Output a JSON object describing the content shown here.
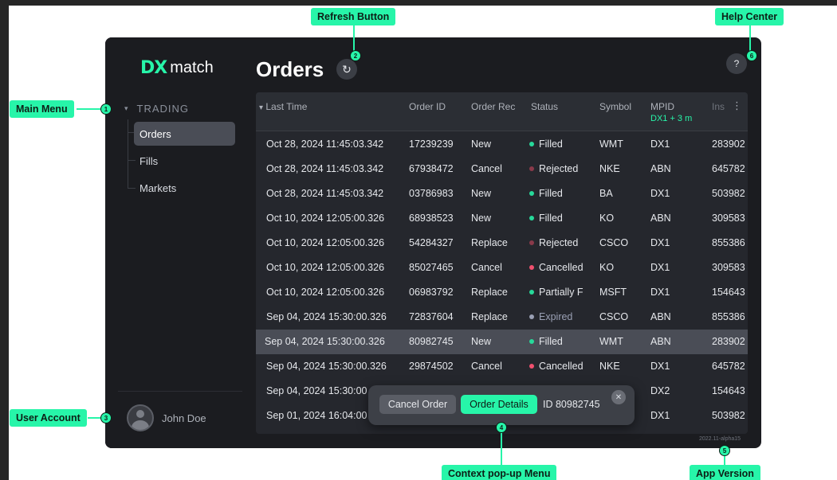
{
  "app": {
    "logo_mark": "DX",
    "logo_text": "match",
    "title": "Orders",
    "version": "2022.11-alpha15"
  },
  "sidebar": {
    "section": "TRADING",
    "items": [
      {
        "label": "Orders",
        "active": true
      },
      {
        "label": "Fills",
        "active": false
      },
      {
        "label": "Markets",
        "active": false
      }
    ],
    "user_name": "John Doe"
  },
  "table": {
    "columns": [
      "Last Time",
      "Order ID",
      "Order Rec",
      "Status",
      "Symbol",
      "MPID",
      "Ins"
    ],
    "mpid_filter": "DX1 + 3 m",
    "rows": [
      {
        "time": "Oct 28, 2024 11:45:03.342",
        "order_id": "17239239",
        "order_rec": "New",
        "status": "Filled",
        "status_color": "#27d99a",
        "symbol": "WMT",
        "mpid": "DX1",
        "ins": "283902"
      },
      {
        "time": "Oct 28, 2024 11:45:03.342",
        "order_id": "67938472",
        "order_rec": "Cancel",
        "status": "Rejected",
        "status_color": "#8a3a4a",
        "symbol": "NKE",
        "mpid": "ABN",
        "ins": "645782"
      },
      {
        "time": "Oct 28, 2024 11:45:03.342",
        "order_id": "03786983",
        "order_rec": "New",
        "status": "Filled",
        "status_color": "#27d99a",
        "symbol": "BA",
        "mpid": "DX1",
        "ins": "503982"
      },
      {
        "time": "Oct 10, 2024 12:05:00.326",
        "order_id": "68938523",
        "order_rec": "New",
        "status": "Filled",
        "status_color": "#27d99a",
        "symbol": "KO",
        "mpid": "ABN",
        "ins": "309583"
      },
      {
        "time": "Oct 10, 2024 12:05:00.326",
        "order_id": "54284327",
        "order_rec": "Replace",
        "status": "Rejected",
        "status_color": "#8a3a4a",
        "symbol": "CSCO",
        "mpid": "DX1",
        "ins": "855386"
      },
      {
        "time": "Oct 10, 2024 12:05:00.326",
        "order_id": "85027465",
        "order_rec": "Cancel",
        "status": "Cancelled",
        "status_color": "#f0506e",
        "symbol": "KO",
        "mpid": "DX1",
        "ins": "309583"
      },
      {
        "time": "Oct 10, 2024 12:05:00.326",
        "order_id": "06983792",
        "order_rec": "Replace",
        "status": "Partially F",
        "status_color": "#27d99a",
        "symbol": "MSFT",
        "mpid": "DX1",
        "ins": "154643"
      },
      {
        "time": "Sep 04, 2024 15:30:00.326",
        "order_id": "72837604",
        "order_rec": "Replace",
        "status": "Expired",
        "status_color": "#9aa0b4",
        "symbol": "CSCO",
        "mpid": "ABN",
        "ins": "855386"
      },
      {
        "time": "Sep 04, 2024 15:30:00.326",
        "order_id": "80982745",
        "order_rec": "New",
        "status": "Filled",
        "status_color": "#27d99a",
        "symbol": "WMT",
        "mpid": "ABN",
        "ins": "283902"
      },
      {
        "time": "Sep 04, 2024 15:30:00.326",
        "order_id": "29874502",
        "order_rec": "Cancel",
        "status": "Cancelled",
        "status_color": "#f0506e",
        "symbol": "NKE",
        "mpid": "DX1",
        "ins": "645782"
      },
      {
        "time": "Sep 04, 2024 15:30:00",
        "order_id": "",
        "order_rec": "",
        "status": "",
        "status_color": "",
        "symbol": "",
        "mpid": "DX2",
        "ins": "154643"
      },
      {
        "time": "Sep 01, 2024 16:04:00",
        "order_id": "",
        "order_rec": "",
        "status": "",
        "status_color": "",
        "symbol": "",
        "mpid": "DX1",
        "ins": "503982"
      }
    ],
    "selected_row": 8
  },
  "context_menu": {
    "cancel_label": "Cancel Order",
    "details_label": "Order Details",
    "id_text": "ID 80982745",
    "close_glyph": "✕"
  },
  "icons": {
    "refresh": "↻",
    "help": "?",
    "sort": "▾",
    "kebab": "⋮",
    "caret": "▾"
  },
  "annotations": [
    {
      "num": "1",
      "label": "Main Menu"
    },
    {
      "num": "2",
      "label": "Refresh Button"
    },
    {
      "num": "3",
      "label": "User Account"
    },
    {
      "num": "4",
      "label": "Context pop-up Menu"
    },
    {
      "num": "5",
      "label": "App Version"
    },
    {
      "num": "6",
      "label": "Help Center"
    }
  ],
  "colors": {
    "accent": "#27f5a9",
    "panel": "#1b1c20",
    "table": "#25272d"
  }
}
